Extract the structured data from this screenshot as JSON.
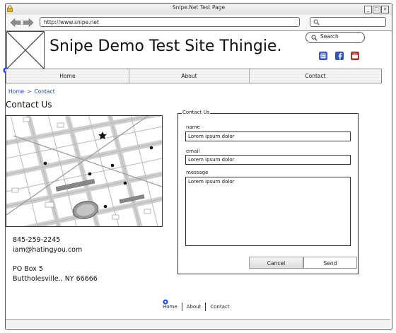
{
  "window": {
    "title": "Snipe.Net Test Page"
  },
  "browser": {
    "url": "http://www.snipe.net"
  },
  "header": {
    "site_title": "Snipe Demo Test Site Thingie.",
    "search_placeholder": "Search"
  },
  "social": [
    {
      "icon": "blog-icon",
      "color": "#3b5bdb"
    },
    {
      "icon": "facebook-icon",
      "color": "#2b55c4"
    },
    {
      "icon": "youtube-icon",
      "color": "#c0392b"
    }
  ],
  "nav": {
    "items": [
      {
        "label": "Home"
      },
      {
        "label": "About"
      },
      {
        "label": "Contact"
      }
    ]
  },
  "breadcrumb": {
    "home": "Home",
    "separator": ">",
    "current": "Contact"
  },
  "page": {
    "heading": "Contact Us"
  },
  "contact": {
    "phone": "845-259-2245",
    "email": "iam@hatingyou.com",
    "address_line1": "PO Box 5",
    "address_line2": "Buttholesville., NY 66666"
  },
  "form": {
    "legend": "Contact Us",
    "name_label": "name",
    "name_value": "Lorem ipsum dolor",
    "email_label": "email",
    "email_value": "Lorem ipsum dolor",
    "message_label": "message",
    "message_value": "Lorem ipsum dolor",
    "cancel_label": "Cancel",
    "send_label": "Send"
  },
  "footer": {
    "items": [
      {
        "label": "Home"
      },
      {
        "label": "About"
      },
      {
        "label": "Contact"
      }
    ]
  }
}
